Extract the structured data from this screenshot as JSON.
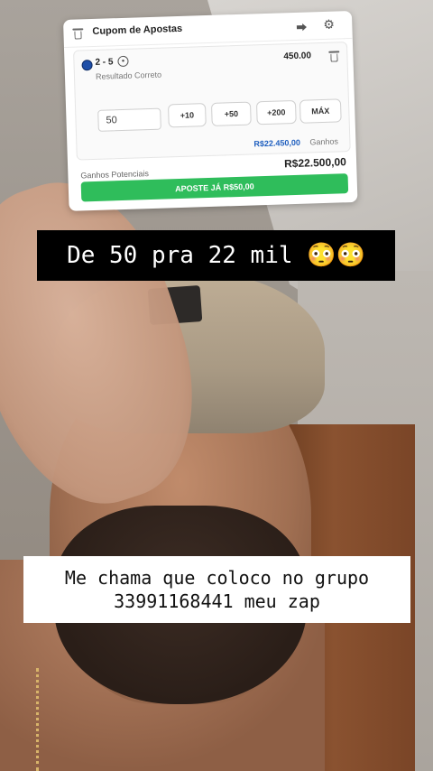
{
  "captions": {
    "top": "De 50 pra 22 mil 😳😳",
    "bottom_line1": "Me chama que coloco no grupo",
    "bottom_line2": "33991168441 meu zap"
  },
  "slip": {
    "title": "Cupom de Apostas",
    "pick": {
      "score": "2 - 5",
      "market": "Resultado Correto",
      "odds": "450.00"
    },
    "stake": {
      "value": "50"
    },
    "quick_stakes": [
      "+10",
      "+50",
      "+200",
      "MÁX"
    ],
    "potential_return_value": "R$22.450,00",
    "potential_return_label": "Ganhos",
    "potential_label": "Ganhos Potenciais",
    "potential_value": "R$22.500,00",
    "bet_button": "APOSTE JÁ R$50,00",
    "icons": {
      "delete": "trash-icon",
      "share": "share-icon",
      "settings": "gear-icon",
      "sport": "soccer-ball-icon",
      "live": "live-icon"
    }
  },
  "colors": {
    "bet_button": "#2fbd5b",
    "return_value": "#1f5fbf",
    "caption_top_bg": "#000000",
    "caption_bottom_bg": "#ffffff"
  }
}
